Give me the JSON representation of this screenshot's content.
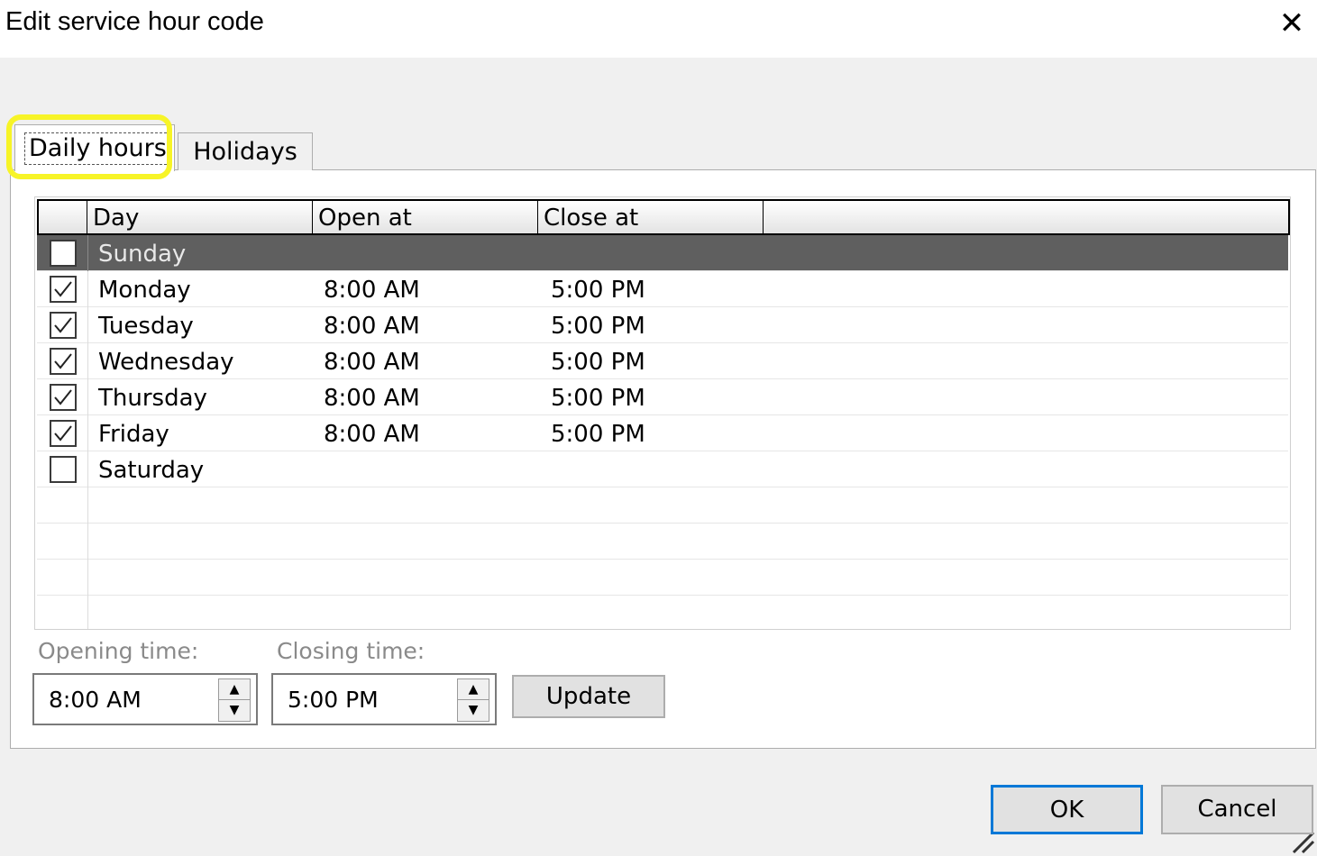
{
  "window": {
    "title": "Edit service hour code",
    "close_glyph": "✕"
  },
  "tabs": [
    {
      "label": "Daily hours",
      "selected": true
    },
    {
      "label": "Holidays",
      "selected": false
    }
  ],
  "grid": {
    "columns": [
      "Day",
      "Open at",
      "Close at"
    ],
    "rows": [
      {
        "day": "Sunday",
        "open": "",
        "close": "",
        "checked": false,
        "selected": true
      },
      {
        "day": "Monday",
        "open": "8:00 AM",
        "close": "5:00 PM",
        "checked": true,
        "selected": false
      },
      {
        "day": "Tuesday",
        "open": "8:00 AM",
        "close": "5:00 PM",
        "checked": true,
        "selected": false
      },
      {
        "day": "Wednesday",
        "open": "8:00 AM",
        "close": "5:00 PM",
        "checked": true,
        "selected": false
      },
      {
        "day": "Thursday",
        "open": "8:00 AM",
        "close": "5:00 PM",
        "checked": true,
        "selected": false
      },
      {
        "day": "Friday",
        "open": "8:00 AM",
        "close": "5:00 PM",
        "checked": true,
        "selected": false
      },
      {
        "day": "Saturday",
        "open": "",
        "close": "",
        "checked": false,
        "selected": false
      }
    ]
  },
  "opening": {
    "label": "Opening time:",
    "value": "8:00 AM"
  },
  "closing": {
    "label": "Closing time:",
    "value": "5:00 PM"
  },
  "buttons": {
    "update": "Update",
    "ok": "OK",
    "cancel": "Cancel"
  },
  "colors": {
    "highlight": "#f7f427",
    "selected_row": "#5f5f5f",
    "ok_border": "#0078d7"
  }
}
